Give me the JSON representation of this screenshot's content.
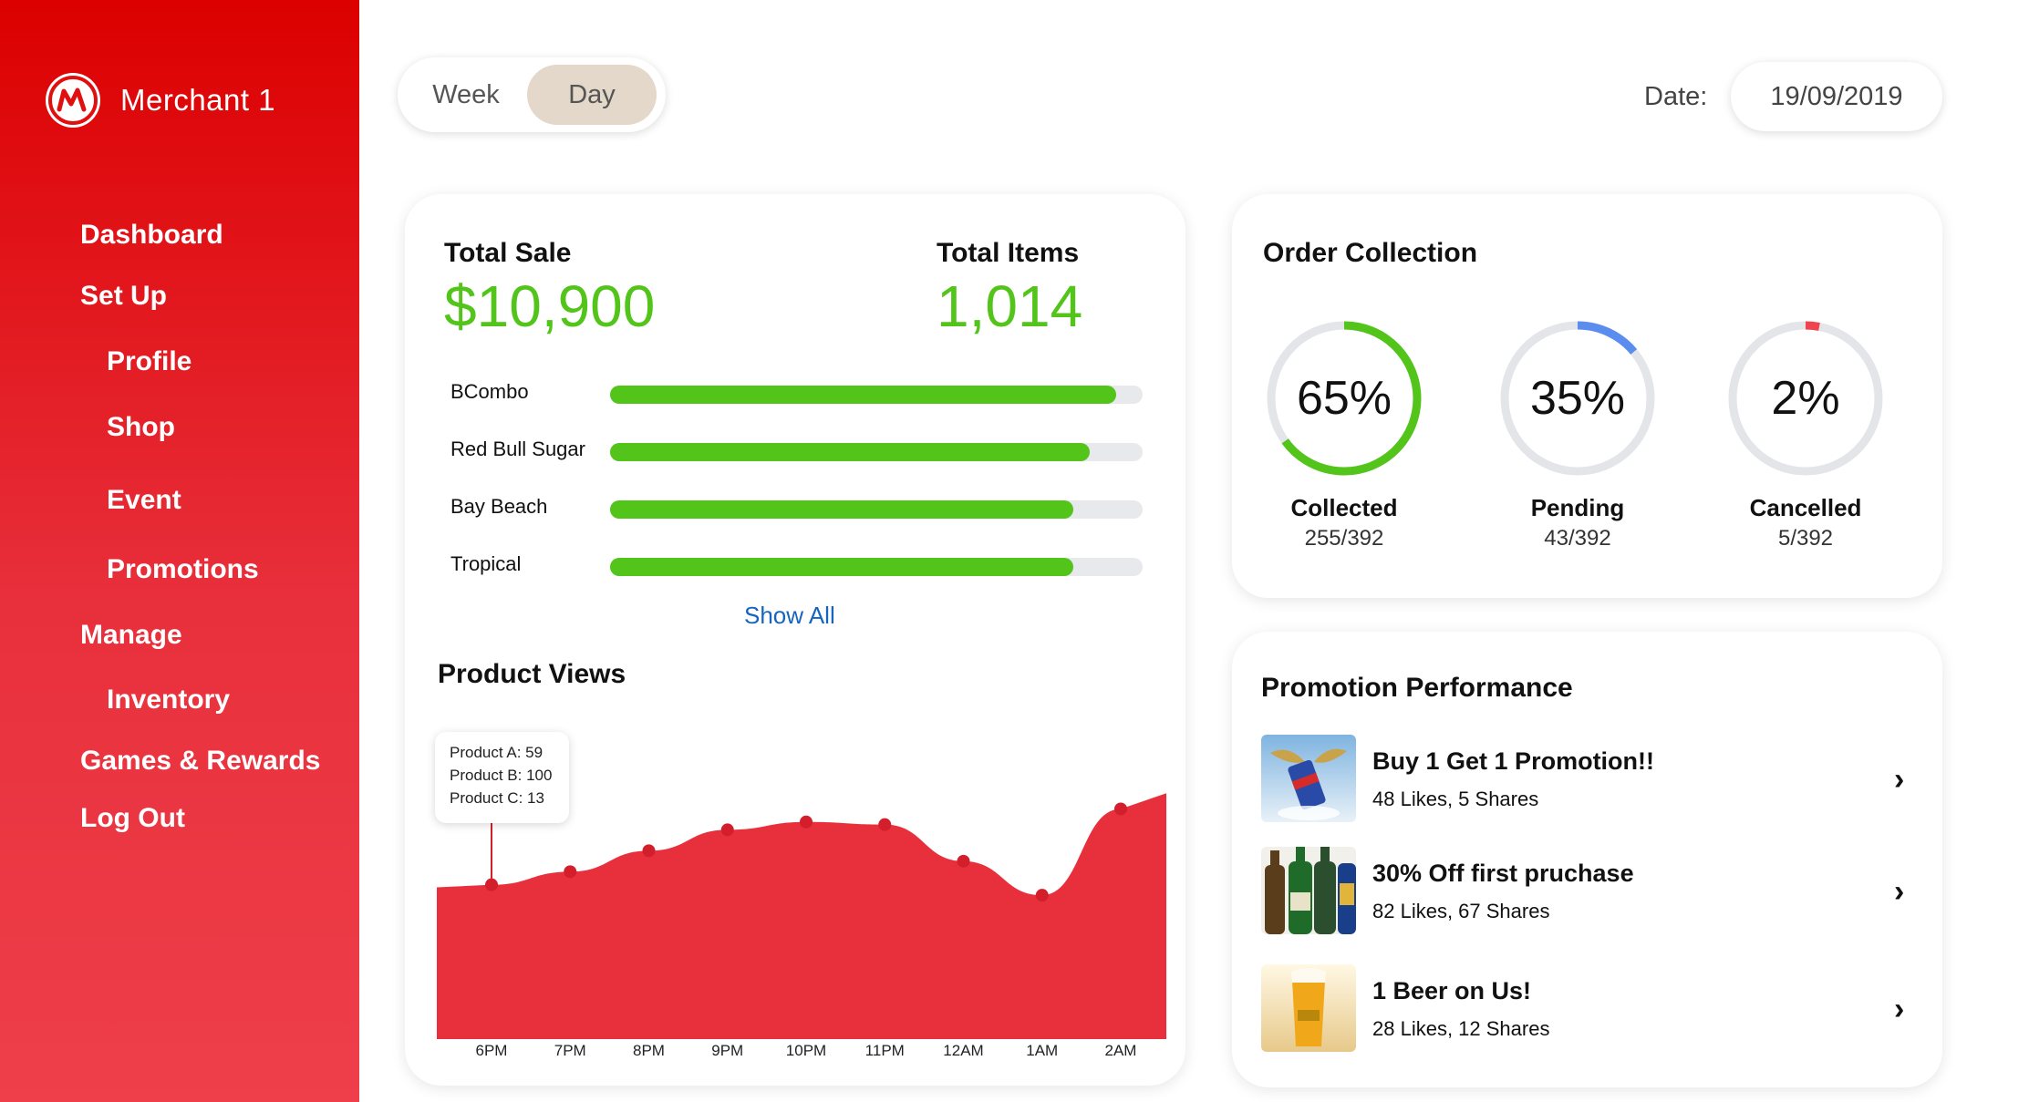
{
  "brand": {
    "name": "Merchant 1",
    "accent": "#dc0000"
  },
  "nav": {
    "dashboard": "Dashboard",
    "setup": "Set Up",
    "profile": "Profile",
    "shop": "Shop",
    "event": "Event",
    "promotions": "Promotions",
    "manage": "Manage",
    "inventory": "Inventory",
    "games_rewards": "Games & Rewards",
    "logout": "Log Out"
  },
  "period_toggle": {
    "week": "Week",
    "day": "Day",
    "selected": "Day"
  },
  "date": {
    "label": "Date:",
    "value": "19/09/2019"
  },
  "sales": {
    "total_sale_label": "Total Sale",
    "total_sale_value": "$10,900",
    "total_items_label": "Total Items",
    "total_items_value": "1,014",
    "products": [
      {
        "name": "BCombo",
        "fill_percent": 95
      },
      {
        "name": "Red Bull Sugar",
        "fill_percent": 90
      },
      {
        "name": "Bay Beach",
        "fill_percent": 87
      },
      {
        "name": "Tropical",
        "fill_percent": 87
      }
    ],
    "show_all": "Show All"
  },
  "product_views": {
    "title": "Product Views",
    "tooltip": [
      "Product A: 59",
      "Product B: 100",
      "Product C: 13"
    ]
  },
  "chart_data": {
    "type": "area",
    "title": "Product Views",
    "categories": [
      "6PM",
      "7PM",
      "8PM",
      "9PM",
      "10PM",
      "11PM",
      "12AM",
      "1AM",
      "2AM"
    ],
    "series": [
      {
        "values": [
          59,
          64,
          72,
          80,
          83,
          82,
          68,
          55,
          88
        ]
      }
    ],
    "color": "#e8303c",
    "ylim": [
      0,
      100
    ],
    "grid": false
  },
  "orders": {
    "title": "Order Collection",
    "items": [
      {
        "pct_label": "65%",
        "pct": 65,
        "title": "Collected",
        "count": "255/392",
        "color": "#52c41a"
      },
      {
        "pct_label": "35%",
        "pct": 14,
        "title": "Pending",
        "count": "43/392",
        "color": "#5b8def"
      },
      {
        "pct_label": "2%",
        "pct": 3,
        "title": "Cancelled",
        "count": "5/392",
        "color": "#f0434d"
      }
    ]
  },
  "promotions": {
    "title": "Promotion Performance",
    "items": [
      {
        "title": "Buy 1 Get 1 Promotion!!",
        "stats": "48 Likes, 5 Shares"
      },
      {
        "title": "30% Off first pruchase",
        "stats": "82 Likes, 67 Shares"
      },
      {
        "title": "1 Beer on Us!",
        "stats": "28 Likes, 12 Shares"
      }
    ]
  }
}
